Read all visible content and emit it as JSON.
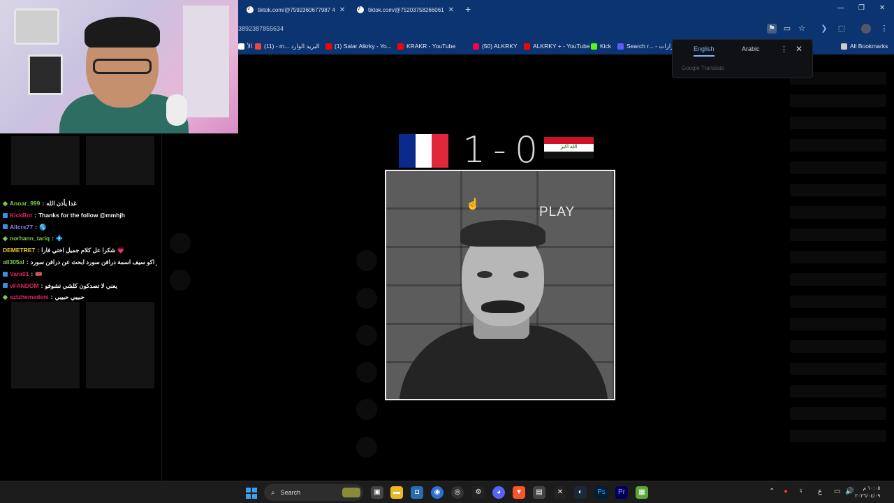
{
  "browser": {
    "tabs": [
      {
        "title": "tiktok.com/@7592360677987 4"
      },
      {
        "title": "tiktok.com/@75203758266061"
      }
    ],
    "address": "3892387855634",
    "bookmarks": [
      {
        "label": "الأ",
        "color": "#ffffff"
      },
      {
        "label": "(11) - m... البريد الوارد",
        "color": "#e44"
      },
      {
        "label": "(1) Salar Alkrky - Yo...",
        "color": "#f00"
      },
      {
        "label": "KRAKR - YouTube",
        "color": "#f00"
      },
      {
        "label": "(50) ALKRKY",
        "color": "#f04"
      },
      {
        "label": "ALKRKY + - YouTube",
        "color": "#f00"
      },
      {
        "label": "Kick",
        "color": "#53fc18"
      },
      {
        "label": "Search r... - قرارات",
        "color": "#5b5bff"
      },
      {
        "label": "All Bookmarks",
        "color": "#cccccc"
      }
    ]
  },
  "translate_popup": {
    "lang_active": "English",
    "lang_other": "Arabic",
    "footer": "Google Translate"
  },
  "game": {
    "score_left": "1",
    "score_sep": "-",
    "score_right": "0",
    "left_team": "France",
    "right_team": "Iraq",
    "right_flag_text": "الله اكبر",
    "card_label": "PLAY"
  },
  "chat": [
    {
      "user": "Anoar_999",
      "user_color": "#7ecb4c",
      "text": "غدا يأذن الله",
      "icon": "diamond"
    },
    {
      "user": "KickBot",
      "user_color": "#e0245e",
      "text": "Thanks for the follow @mmhjh",
      "icon": "badge"
    },
    {
      "user": "Allcrs77",
      "user_color": "#8f7ff0",
      "text": "🌎",
      "icon": "badge"
    },
    {
      "user": "norhann_tariq",
      "user_color": "#7ecb4c",
      "text": "💠",
      "icon": "diamond"
    },
    {
      "user": "DEMETRE7",
      "user_color": "#f2d230",
      "text": "شكرا عل كلام جميل اختي فارا 💗",
      "icon": "none"
    },
    {
      "user": "all305al",
      "user_color": "#7ecb4c",
      "text": "يسبرفر اكو سيف اسمة درافن سورد ابحث عن درافن سورد",
      "icon": "none"
    },
    {
      "user": "Vara01",
      "user_color": "#e0245e",
      "text": "🎟️",
      "icon": "badge"
    },
    {
      "user": "vFANDOM",
      "user_color": "#e0245e",
      "text": "يعني لا تصدكون كلشي تشوفو",
      "icon": "badge"
    },
    {
      "user": "aztzhemedeni",
      "user_color": "#e0245e",
      "text": "حبيبي حبيبي",
      "icon": "diamond"
    }
  ],
  "taskbar": {
    "search_label": "Search",
    "clock_time": "١٠:٠٥ م",
    "clock_date": "٢٠٢٦/٠٤/٠٩"
  },
  "colors": {
    "chrome_blue": "#0c3470",
    "accent": "#8ab4f8"
  }
}
